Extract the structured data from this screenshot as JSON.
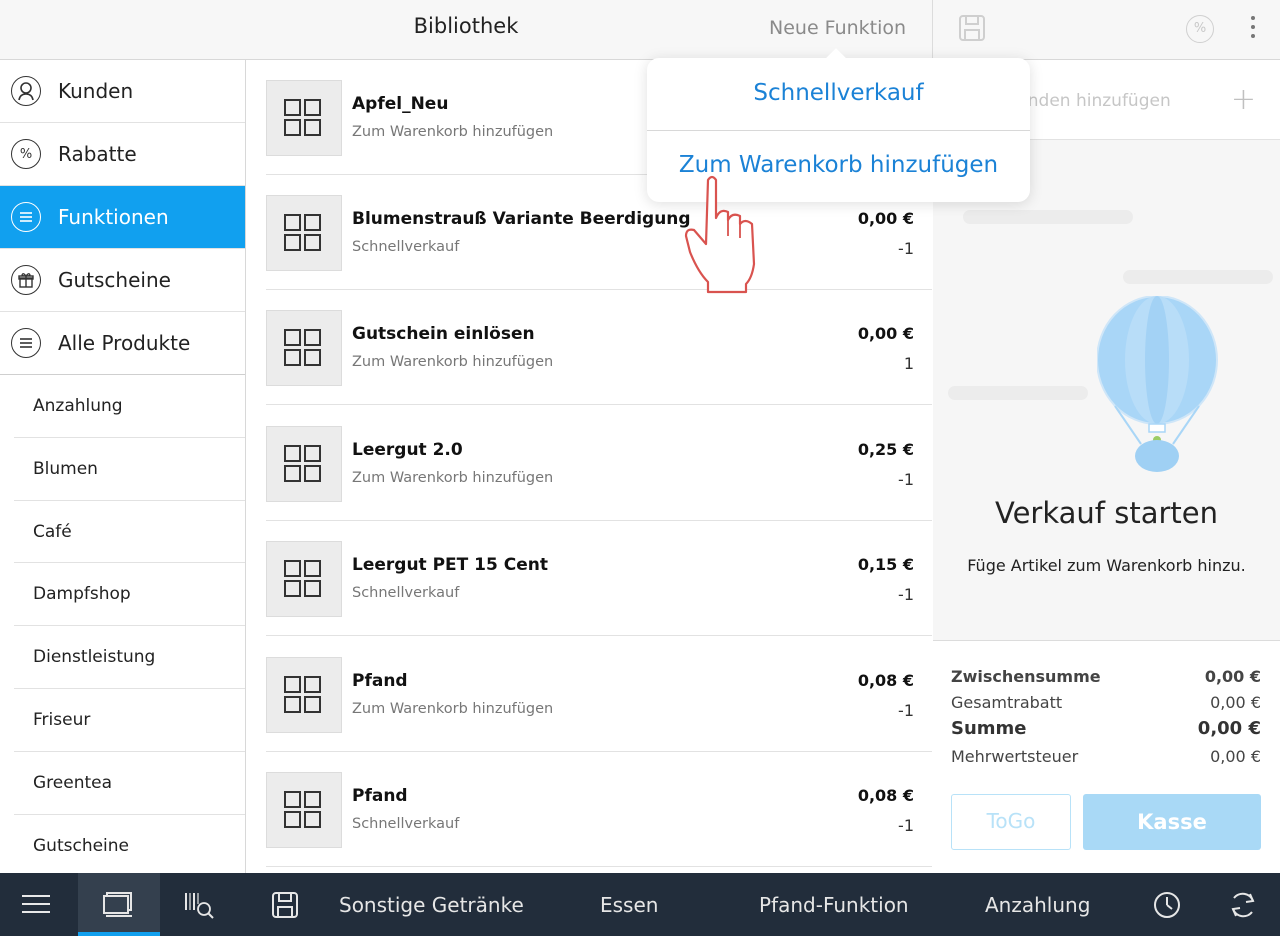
{
  "topbar": {
    "title": "Bibliothek",
    "new_function": "Neue Funktion",
    "save_icon": "save-icon",
    "discount_icon": "%",
    "more_icon": "more-vertical-icon"
  },
  "sidebar": {
    "main_items": [
      {
        "label": "Kunden",
        "icon": "person-icon",
        "active": false
      },
      {
        "label": "Rabatte",
        "icon": "%",
        "active": false
      },
      {
        "label": "Funktionen",
        "icon": "list-icon",
        "active": true
      },
      {
        "label": "Gutscheine",
        "icon": "gift-icon",
        "active": false
      },
      {
        "label": "Alle Produkte",
        "icon": "list-icon",
        "active": false
      }
    ],
    "categories": [
      "Anzahlung",
      "Blumen",
      "Café",
      "Dampfshop",
      "Dienstleistung",
      "Friseur",
      "Greentea",
      "Gutscheine"
    ]
  },
  "list": {
    "rows": [
      {
        "name": "Apfel_Neu",
        "sub": "Zum Warenkorb hinzufügen",
        "price": "",
        "qty": ""
      },
      {
        "name": "Blumenstrauß Variante Beerdigung",
        "sub": "Schnellverkauf",
        "price": "0,00 €",
        "qty": "-1"
      },
      {
        "name": "Gutschein einlösen",
        "sub": "Zum Warenkorb hinzufügen",
        "price": "0,00 €",
        "qty": "1"
      },
      {
        "name": "Leergut 2.0",
        "sub": "Zum Warenkorb hinzufügen",
        "price": "0,25 €",
        "qty": "-1"
      },
      {
        "name": "Leergut PET 15 Cent",
        "sub": "Schnellverkauf",
        "price": "0,15 €",
        "qty": "-1"
      },
      {
        "name": "Pfand",
        "sub": "Zum Warenkorb hinzufügen",
        "price": "0,08 €",
        "qty": "-1"
      },
      {
        "name": "Pfand",
        "sub": "Schnellverkauf",
        "price": "0,08 €",
        "qty": "-1"
      }
    ]
  },
  "popover": {
    "options": [
      "Schnellverkauf",
      "Zum Warenkorb hinzufügen"
    ]
  },
  "cart": {
    "customer_placeholder": "unden hinzufügen",
    "empty_title": "Verkauf starten",
    "empty_subtitle": "Füge Artikel zum Warenkorb hinzu.",
    "totals": {
      "subtotal_label": "Zwischensumme",
      "subtotal_value": "0,00 €",
      "discount_label": "Gesamtrabatt",
      "discount_value": "0,00 €",
      "sum_label": "Summe",
      "sum_value": "0,00 €",
      "vat_label": "Mehrwertsteuer",
      "vat_value": "0,00 €"
    },
    "togo_label": "ToGo",
    "checkout_label": "Kasse"
  },
  "bottombar": {
    "tabs": [
      "Sonstige Getränke",
      "Essen",
      "Pfand-Funktion",
      "Anzahlung"
    ],
    "icons": [
      "menu-icon",
      "register-icon",
      "barcode-search-icon",
      "save-icon",
      "clock-icon",
      "sync-icon"
    ]
  },
  "colors": {
    "accent": "#11a0ef",
    "popover_text": "#1b82d6",
    "bottombar": "#222d3b",
    "checkout_button": "#a9d9f6",
    "hand_cursor": "#d9534f"
  }
}
